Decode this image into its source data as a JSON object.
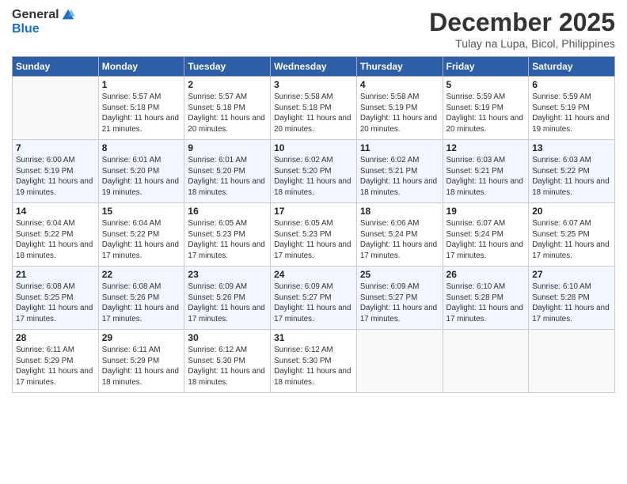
{
  "logo": {
    "text_general": "General",
    "text_blue": "Blue"
  },
  "header": {
    "month": "December 2025",
    "location": "Tulay na Lupa, Bicol, Philippines"
  },
  "weekdays": [
    "Sunday",
    "Monday",
    "Tuesday",
    "Wednesday",
    "Thursday",
    "Friday",
    "Saturday"
  ],
  "weeks": [
    [
      {
        "day": "",
        "sunrise": "",
        "sunset": "",
        "daylight": ""
      },
      {
        "day": "1",
        "sunrise": "Sunrise: 5:57 AM",
        "sunset": "Sunset: 5:18 PM",
        "daylight": "Daylight: 11 hours and 21 minutes."
      },
      {
        "day": "2",
        "sunrise": "Sunrise: 5:57 AM",
        "sunset": "Sunset: 5:18 PM",
        "daylight": "Daylight: 11 hours and 20 minutes."
      },
      {
        "day": "3",
        "sunrise": "Sunrise: 5:58 AM",
        "sunset": "Sunset: 5:18 PM",
        "daylight": "Daylight: 11 hours and 20 minutes."
      },
      {
        "day": "4",
        "sunrise": "Sunrise: 5:58 AM",
        "sunset": "Sunset: 5:19 PM",
        "daylight": "Daylight: 11 hours and 20 minutes."
      },
      {
        "day": "5",
        "sunrise": "Sunrise: 5:59 AM",
        "sunset": "Sunset: 5:19 PM",
        "daylight": "Daylight: 11 hours and 20 minutes."
      },
      {
        "day": "6",
        "sunrise": "Sunrise: 5:59 AM",
        "sunset": "Sunset: 5:19 PM",
        "daylight": "Daylight: 11 hours and 19 minutes."
      }
    ],
    [
      {
        "day": "7",
        "sunrise": "Sunrise: 6:00 AM",
        "sunset": "Sunset: 5:19 PM",
        "daylight": "Daylight: 11 hours and 19 minutes."
      },
      {
        "day": "8",
        "sunrise": "Sunrise: 6:01 AM",
        "sunset": "Sunset: 5:20 PM",
        "daylight": "Daylight: 11 hours and 19 minutes."
      },
      {
        "day": "9",
        "sunrise": "Sunrise: 6:01 AM",
        "sunset": "Sunset: 5:20 PM",
        "daylight": "Daylight: 11 hours and 18 minutes."
      },
      {
        "day": "10",
        "sunrise": "Sunrise: 6:02 AM",
        "sunset": "Sunset: 5:20 PM",
        "daylight": "Daylight: 11 hours and 18 minutes."
      },
      {
        "day": "11",
        "sunrise": "Sunrise: 6:02 AM",
        "sunset": "Sunset: 5:21 PM",
        "daylight": "Daylight: 11 hours and 18 minutes."
      },
      {
        "day": "12",
        "sunrise": "Sunrise: 6:03 AM",
        "sunset": "Sunset: 5:21 PM",
        "daylight": "Daylight: 11 hours and 18 minutes."
      },
      {
        "day": "13",
        "sunrise": "Sunrise: 6:03 AM",
        "sunset": "Sunset: 5:22 PM",
        "daylight": "Daylight: 11 hours and 18 minutes."
      }
    ],
    [
      {
        "day": "14",
        "sunrise": "Sunrise: 6:04 AM",
        "sunset": "Sunset: 5:22 PM",
        "daylight": "Daylight: 11 hours and 18 minutes."
      },
      {
        "day": "15",
        "sunrise": "Sunrise: 6:04 AM",
        "sunset": "Sunset: 5:22 PM",
        "daylight": "Daylight: 11 hours and 17 minutes."
      },
      {
        "day": "16",
        "sunrise": "Sunrise: 6:05 AM",
        "sunset": "Sunset: 5:23 PM",
        "daylight": "Daylight: 11 hours and 17 minutes."
      },
      {
        "day": "17",
        "sunrise": "Sunrise: 6:05 AM",
        "sunset": "Sunset: 5:23 PM",
        "daylight": "Daylight: 11 hours and 17 minutes."
      },
      {
        "day": "18",
        "sunrise": "Sunrise: 6:06 AM",
        "sunset": "Sunset: 5:24 PM",
        "daylight": "Daylight: 11 hours and 17 minutes."
      },
      {
        "day": "19",
        "sunrise": "Sunrise: 6:07 AM",
        "sunset": "Sunset: 5:24 PM",
        "daylight": "Daylight: 11 hours and 17 minutes."
      },
      {
        "day": "20",
        "sunrise": "Sunrise: 6:07 AM",
        "sunset": "Sunset: 5:25 PM",
        "daylight": "Daylight: 11 hours and 17 minutes."
      }
    ],
    [
      {
        "day": "21",
        "sunrise": "Sunrise: 6:08 AM",
        "sunset": "Sunset: 5:25 PM",
        "daylight": "Daylight: 11 hours and 17 minutes."
      },
      {
        "day": "22",
        "sunrise": "Sunrise: 6:08 AM",
        "sunset": "Sunset: 5:26 PM",
        "daylight": "Daylight: 11 hours and 17 minutes."
      },
      {
        "day": "23",
        "sunrise": "Sunrise: 6:09 AM",
        "sunset": "Sunset: 5:26 PM",
        "daylight": "Daylight: 11 hours and 17 minutes."
      },
      {
        "day": "24",
        "sunrise": "Sunrise: 6:09 AM",
        "sunset": "Sunset: 5:27 PM",
        "daylight": "Daylight: 11 hours and 17 minutes."
      },
      {
        "day": "25",
        "sunrise": "Sunrise: 6:09 AM",
        "sunset": "Sunset: 5:27 PM",
        "daylight": "Daylight: 11 hours and 17 minutes."
      },
      {
        "day": "26",
        "sunrise": "Sunrise: 6:10 AM",
        "sunset": "Sunset: 5:28 PM",
        "daylight": "Daylight: 11 hours and 17 minutes."
      },
      {
        "day": "27",
        "sunrise": "Sunrise: 6:10 AM",
        "sunset": "Sunset: 5:28 PM",
        "daylight": "Daylight: 11 hours and 17 minutes."
      }
    ],
    [
      {
        "day": "28",
        "sunrise": "Sunrise: 6:11 AM",
        "sunset": "Sunset: 5:29 PM",
        "daylight": "Daylight: 11 hours and 17 minutes."
      },
      {
        "day": "29",
        "sunrise": "Sunrise: 6:11 AM",
        "sunset": "Sunset: 5:29 PM",
        "daylight": "Daylight: 11 hours and 18 minutes."
      },
      {
        "day": "30",
        "sunrise": "Sunrise: 6:12 AM",
        "sunset": "Sunset: 5:30 PM",
        "daylight": "Daylight: 11 hours and 18 minutes."
      },
      {
        "day": "31",
        "sunrise": "Sunrise: 6:12 AM",
        "sunset": "Sunset: 5:30 PM",
        "daylight": "Daylight: 11 hours and 18 minutes."
      },
      {
        "day": "",
        "sunrise": "",
        "sunset": "",
        "daylight": ""
      },
      {
        "day": "",
        "sunrise": "",
        "sunset": "",
        "daylight": ""
      },
      {
        "day": "",
        "sunrise": "",
        "sunset": "",
        "daylight": ""
      }
    ]
  ]
}
